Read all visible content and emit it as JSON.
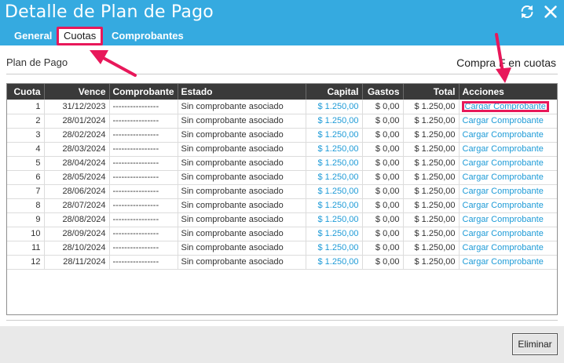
{
  "window": {
    "title": "Detalle de Plan de Pago",
    "header_color": "#35aae0",
    "accent_color": "#e8185a"
  },
  "icons": {
    "refresh": "refresh-icon",
    "close": "close-icon"
  },
  "tabs": [
    {
      "label": "General",
      "active": false
    },
    {
      "label": "Cuotas",
      "active": true
    },
    {
      "label": "Comprobantes",
      "active": false
    }
  ],
  "section": {
    "label": "Plan de Pago",
    "right_label": "Compra F   en cuotas"
  },
  "table": {
    "headers": [
      "Cuota",
      "Vence",
      "Comprobante",
      "Estado",
      "Capital",
      "Gastos",
      "Total",
      "Acciones"
    ],
    "rows": [
      {
        "cuota": "1",
        "vence": "31/12/2023",
        "comprobante": "----------------",
        "estado": "Sin comprobante asociado",
        "capital": "$ 1.250,00",
        "gastos": "$ 0,00",
        "total": "$ 1.250,00",
        "accion": "Cargar Comprobante"
      },
      {
        "cuota": "2",
        "vence": "28/01/2024",
        "comprobante": "----------------",
        "estado": "Sin comprobante asociado",
        "capital": "$ 1.250,00",
        "gastos": "$ 0,00",
        "total": "$ 1.250,00",
        "accion": "Cargar Comprobante"
      },
      {
        "cuota": "3",
        "vence": "28/02/2024",
        "comprobante": "----------------",
        "estado": "Sin comprobante asociado",
        "capital": "$ 1.250,00",
        "gastos": "$ 0,00",
        "total": "$ 1.250,00",
        "accion": "Cargar Comprobante"
      },
      {
        "cuota": "4",
        "vence": "28/03/2024",
        "comprobante": "----------------",
        "estado": "Sin comprobante asociado",
        "capital": "$ 1.250,00",
        "gastos": "$ 0,00",
        "total": "$ 1.250,00",
        "accion": "Cargar Comprobante"
      },
      {
        "cuota": "5",
        "vence": "28/04/2024",
        "comprobante": "----------------",
        "estado": "Sin comprobante asociado",
        "capital": "$ 1.250,00",
        "gastos": "$ 0,00",
        "total": "$ 1.250,00",
        "accion": "Cargar Comprobante"
      },
      {
        "cuota": "6",
        "vence": "28/05/2024",
        "comprobante": "----------------",
        "estado": "Sin comprobante asociado",
        "capital": "$ 1.250,00",
        "gastos": "$ 0,00",
        "total": "$ 1.250,00",
        "accion": "Cargar Comprobante"
      },
      {
        "cuota": "7",
        "vence": "28/06/2024",
        "comprobante": "----------------",
        "estado": "Sin comprobante asociado",
        "capital": "$ 1.250,00",
        "gastos": "$ 0,00",
        "total": "$ 1.250,00",
        "accion": "Cargar Comprobante"
      },
      {
        "cuota": "8",
        "vence": "28/07/2024",
        "comprobante": "----------------",
        "estado": "Sin comprobante asociado",
        "capital": "$ 1.250,00",
        "gastos": "$ 0,00",
        "total": "$ 1.250,00",
        "accion": "Cargar Comprobante"
      },
      {
        "cuota": "9",
        "vence": "28/08/2024",
        "comprobante": "----------------",
        "estado": "Sin comprobante asociado",
        "capital": "$ 1.250,00",
        "gastos": "$ 0,00",
        "total": "$ 1.250,00",
        "accion": "Cargar Comprobante"
      },
      {
        "cuota": "10",
        "vence": "28/09/2024",
        "comprobante": "----------------",
        "estado": "Sin comprobante asociado",
        "capital": "$ 1.250,00",
        "gastos": "$ 0,00",
        "total": "$ 1.250,00",
        "accion": "Cargar Comprobante"
      },
      {
        "cuota": "11",
        "vence": "28/10/2024",
        "comprobante": "----------------",
        "estado": "Sin comprobante asociado",
        "capital": "$ 1.250,00",
        "gastos": "$ 0,00",
        "total": "$ 1.250,00",
        "accion": "Cargar Comprobante"
      },
      {
        "cuota": "12",
        "vence": "28/11/2024",
        "comprobante": "----------------",
        "estado": "Sin comprobante asociado",
        "capital": "$ 1.250,00",
        "gastos": "$ 0,00",
        "total": "$ 1.250,00",
        "accion": "Cargar Comprobante"
      }
    ]
  },
  "footer": {
    "delete_label": "Eliminar"
  }
}
